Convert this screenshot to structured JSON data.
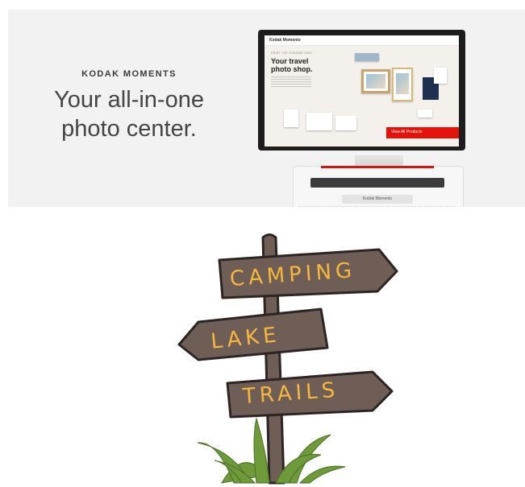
{
  "banner": {
    "brand": "KODAK MOMENTS",
    "headline_line1": "Your all-in-one",
    "headline_line2": "photo center.",
    "kiosk": {
      "screen_logo": "Kodak Moments",
      "screen_label": "PRINT THE POSSIBILITIES",
      "screen_title": "Your travel photo shop.",
      "screen_button": "View All Products",
      "body_logo": "Kodak Moments"
    }
  },
  "signpost": {
    "signs": [
      "CAMPING",
      "LAKE",
      "TRAILS"
    ]
  },
  "colors": {
    "banner_bg": "#f2f2f2",
    "wood": "#6f5e55",
    "wood_outline": "#2c2523",
    "lettering": "#f6b73c",
    "grass": "#6e9a3a",
    "kodak_red": "#e3120b"
  }
}
